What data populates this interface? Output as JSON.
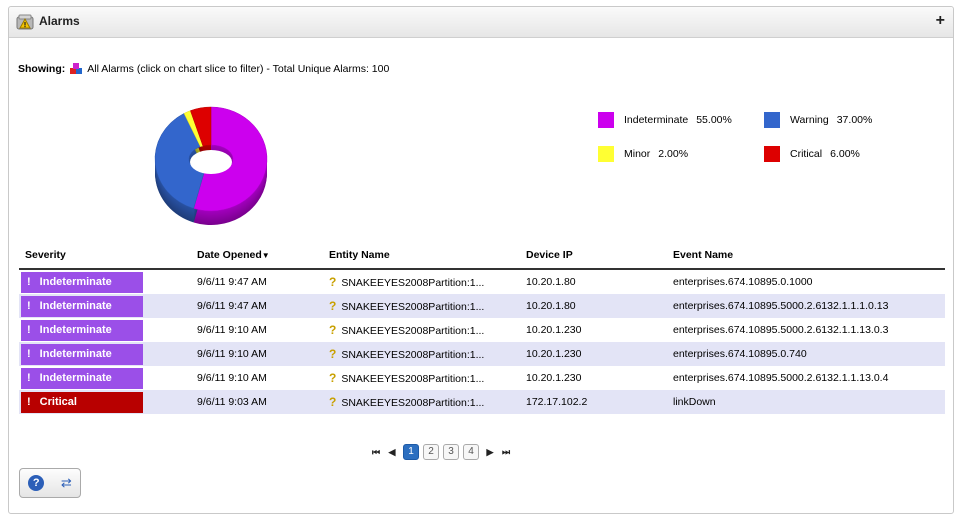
{
  "panel": {
    "title": "Alarms",
    "expand_label": "+"
  },
  "summary": {
    "label": "Showing:",
    "text": "All Alarms (click on chart slice to filter) - Total Unique Alarms: 100"
  },
  "chart_data": {
    "type": "pie",
    "style": "3d-donut",
    "categories": [
      "Indeterminate",
      "Warning",
      "Minor",
      "Critical"
    ],
    "values": [
      55.0,
      37.0,
      2.0,
      6.0
    ],
    "colors": [
      "#cc00ee",
      "#3366cc",
      "#ffff33",
      "#dd0000"
    ],
    "legend_placement": "right",
    "legend": [
      {
        "label": "Indeterminate",
        "pct": "55.00%",
        "color": "#cc00ee"
      },
      {
        "label": "Warning",
        "pct": "37.00%",
        "color": "#3366cc"
      },
      {
        "label": "Minor",
        "pct": "2.00%",
        "color": "#ffff33"
      },
      {
        "label": "Critical",
        "pct": "6.00%",
        "color": "#dd0000"
      }
    ]
  },
  "table": {
    "columns": [
      "Severity",
      "Date Opened",
      "Entity Name",
      "Device IP",
      "Event Name"
    ],
    "sort_indicator": "▼",
    "rows": [
      {
        "severity": "Indeterminate",
        "color": "#9b4fe8",
        "date": "9/6/11 9:47 AM",
        "entity": "SNAKEEYES2008Partition:1...",
        "ip": "10.20.1.80",
        "event": "enterprises.674.10895.0.1000"
      },
      {
        "severity": "Indeterminate",
        "color": "#9b4fe8",
        "date": "9/6/11 9:47 AM",
        "entity": "SNAKEEYES2008Partition:1...",
        "ip": "10.20.1.80",
        "event": "enterprises.674.10895.5000.2.6132.1.1.1.0.13"
      },
      {
        "severity": "Indeterminate",
        "color": "#9b4fe8",
        "date": "9/6/11 9:10 AM",
        "entity": "SNAKEEYES2008Partition:1...",
        "ip": "10.20.1.230",
        "event": "enterprises.674.10895.5000.2.6132.1.1.13.0.3"
      },
      {
        "severity": "Indeterminate",
        "color": "#9b4fe8",
        "date": "9/6/11 9:10 AM",
        "entity": "SNAKEEYES2008Partition:1...",
        "ip": "10.20.1.230",
        "event": "enterprises.674.10895.0.740"
      },
      {
        "severity": "Indeterminate",
        "color": "#9b4fe8",
        "date": "9/6/11 9:10 AM",
        "entity": "SNAKEEYES2008Partition:1...",
        "ip": "10.20.1.230",
        "event": "enterprises.674.10895.5000.2.6132.1.1.13.0.4"
      },
      {
        "severity": "Critical",
        "color": "#b80000",
        "date": "9/6/11 9:03 AM",
        "entity": "SNAKEEYES2008Partition:1...",
        "ip": "172.17.102.2",
        "event": "linkDown"
      }
    ]
  },
  "pager": {
    "pages": [
      "1",
      "2",
      "3",
      "4"
    ],
    "current": "1"
  }
}
